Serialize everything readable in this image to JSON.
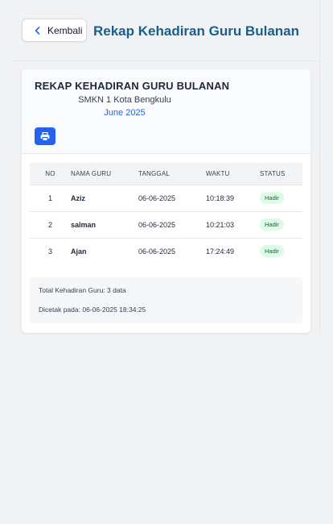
{
  "header": {
    "back_label": "Kembali",
    "title": "Rekap Kehadiran Guru Bulanan"
  },
  "report": {
    "title": "REKAP KEHADIRAN GURU BULANAN",
    "school": "SMKN 1 Kota Bengkulu",
    "period": "June 2025",
    "print_icon": "printer-icon"
  },
  "table": {
    "headers": [
      "NO",
      "NAMA GURU",
      "TANGGAL",
      "WAKTU",
      "STATUS"
    ],
    "rows": [
      {
        "no": "1",
        "name": "Aziz",
        "date": "06-06-2025",
        "time": "10:18:39",
        "status": "Hadir"
      },
      {
        "no": "2",
        "name": "salman",
        "date": "06-06-2025",
        "time": "10:21:03",
        "status": "Hadir"
      },
      {
        "no": "3",
        "name": "Ajan",
        "date": "06-06-2025",
        "time": "17:24:49",
        "status": "Hadir"
      }
    ]
  },
  "summary": {
    "total": "Total Kehadiran Guru: 3 data",
    "printed_at": "Dicetak pada: 06-06-2025 18:34:25"
  },
  "colors": {
    "title": "#1a5f8a",
    "accent": "#2563eb",
    "badge_bg": "#dcfce7",
    "badge_text": "#166534"
  }
}
